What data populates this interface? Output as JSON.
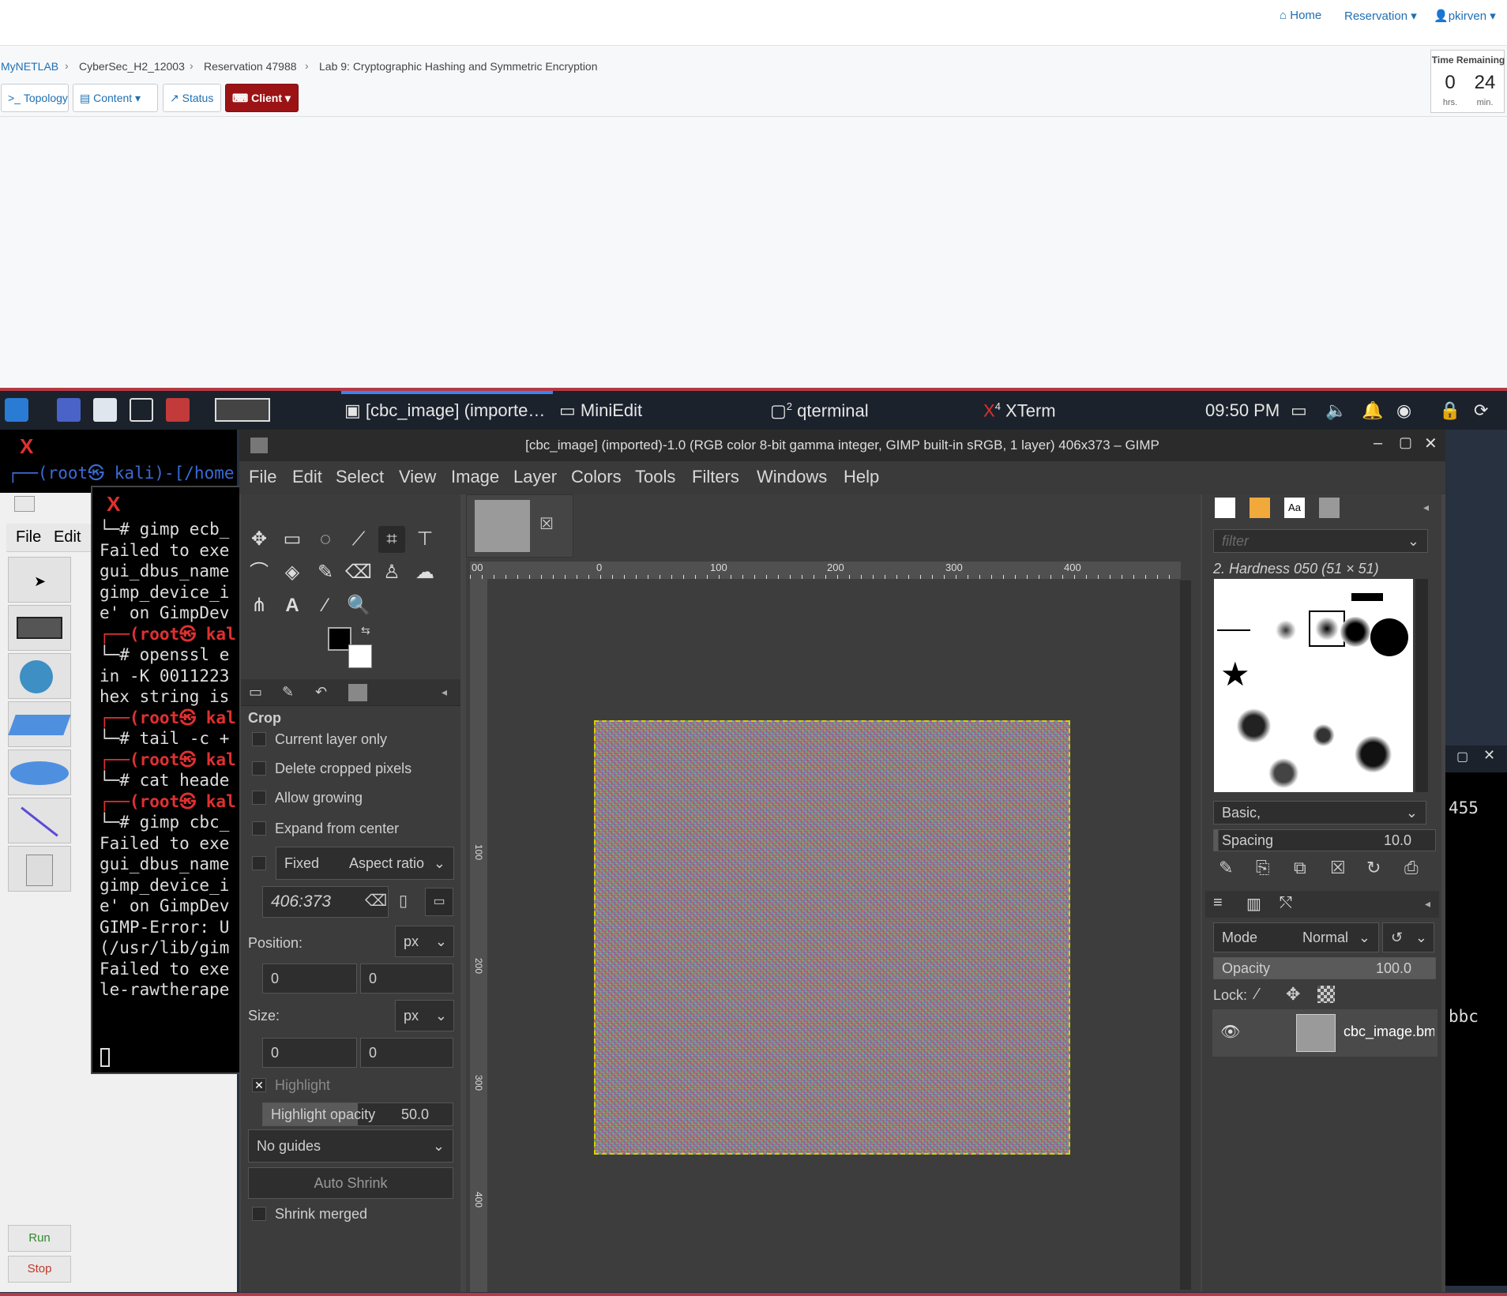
{
  "netlab": {
    "topnav": {
      "home": "Home",
      "reservation": "Reservation",
      "user": "pkirven"
    },
    "breadcrumb": [
      "MyNETLAB",
      "CyberSec_H2_12003",
      "Reservation 47988",
      "Lab 9: Cryptographic Hashing and Symmetric Encryption"
    ],
    "tabs": {
      "topology": "Topology",
      "content": "Content",
      "status": "Status",
      "client": "Client"
    },
    "time": {
      "label": "Time Remaining",
      "hrs": "0",
      "min": "24",
      "hrs_unit": "hrs.",
      "min_unit": "min."
    }
  },
  "taskbar": {
    "items": [
      "[cbc_image] (importe…",
      "MiniEdit",
      "qterminal",
      "XTerm"
    ],
    "qterminal_badge": "2",
    "xterm_badge": "4",
    "clock": "09:50 PM"
  },
  "miniedit": {
    "menu": [
      "File",
      "Edit"
    ],
    "run": "Run",
    "stop": "Stop"
  },
  "xterm_back_prompt": "┌──(root㉿ kali)-[/home",
  "xterm": {
    "lines": [
      "└─# gimp ecb_",
      "Failed to exe",
      "gui_dbus_name",
      "gimp_device_i",
      "e' on GimpDev",
      "┌──(root㉿ kal",
      "└─# openssl e",
      "in -K 0011223",
      "hex string is",
      "┌──(root㉿ kal",
      "└─# tail -c +",
      "┌──(root㉿ kal",
      "└─# cat heade",
      "┌──(root㉿ kal",
      "└─# gimp cbc_",
      "Failed to exe",
      "gui_dbus_name",
      "gimp_device_i",
      "e' on GimpDev",
      "GIMP-Error: U",
      "(/usr/lib/gim",
      "",
      "Failed to exe",
      "le-rawtherape"
    ]
  },
  "gimp": {
    "title": "[cbc_image] (imported)-1.0 (RGB color 8-bit gamma integer, GIMP built-in sRGB, 1 layer) 406x373 – GIMP",
    "menu": [
      "File",
      "Edit",
      "Select",
      "View",
      "Image",
      "Layer",
      "Colors",
      "Tools",
      "Filters",
      "Windows",
      "Help"
    ],
    "tool_options": {
      "heading": "Crop",
      "current_layer_only": "Current layer only",
      "delete_cropped": "Delete cropped pixels",
      "allow_growing": "Allow growing",
      "expand_center": "Expand from center",
      "fixed": "Fixed",
      "aspect": "Aspect ratio",
      "ratio_value": "406:373",
      "position_label": "Position:",
      "size_label": "Size:",
      "unit": "px",
      "pos_x": "0",
      "pos_y": "0",
      "size_x": "0",
      "size_y": "0",
      "highlight": "Highlight",
      "highlight_opacity": "Highlight opacity",
      "highlight_opacity_value": "50.0",
      "guides": "No guides",
      "auto_shrink": "Auto Shrink",
      "shrink_merged": "Shrink merged"
    },
    "rulers": {
      "top": [
        "00",
        "0",
        "100",
        "200",
        "300",
        "400"
      ],
      "left": [
        "100",
        "200",
        "300",
        "400"
      ]
    },
    "brushes": {
      "filter_placeholder": "filter",
      "current": "2. Hardness 050 (51 × 51)",
      "tag": "Basic,",
      "spacing_label": "Spacing",
      "spacing_value": "10.0"
    },
    "layers": {
      "mode_label": "Mode",
      "mode_value": "Normal",
      "opacity_label": "Opacity",
      "opacity_value": "100.0",
      "lock_label": "Lock:",
      "layer_name": "cbc_image.bm"
    }
  },
  "xterm_right": {
    "line1": "455",
    "line2": "bbc"
  }
}
